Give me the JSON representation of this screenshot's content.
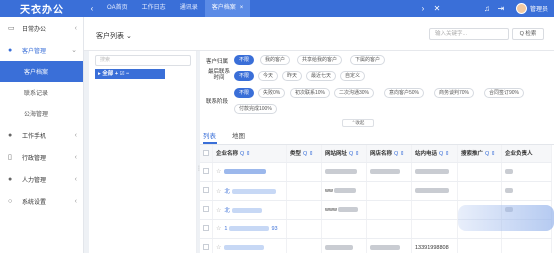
{
  "app": {
    "title": "天衣办公"
  },
  "topnav": {
    "tabs": [
      {
        "label": "OA首页",
        "active": false
      },
      {
        "label": "工作日志",
        "active": false
      },
      {
        "label": "通讯录",
        "active": false
      },
      {
        "label": "客户档案",
        "active": true
      }
    ],
    "close_glyph": "×",
    "user_name": "管理员"
  },
  "sidebar": {
    "items": [
      {
        "label": "日常办公",
        "icon": "monitor-icon"
      },
      {
        "label": "客户管理",
        "icon": "user-icon",
        "open": true
      },
      {
        "label": "工作手机",
        "icon": "user-icon"
      },
      {
        "label": "行政管理",
        "icon": "doc-icon"
      },
      {
        "label": "人力管理",
        "icon": "user-icon"
      },
      {
        "label": "系统设置",
        "icon": "circle-icon"
      }
    ],
    "subitems": [
      "客户档案",
      "联系记录",
      "公海管理"
    ]
  },
  "header": {
    "title": "客户列表",
    "search_placeholder": "输入关键字...",
    "search_button": "Q 检索"
  },
  "tree": {
    "search_placeholder": "搜索",
    "root_label": "全部",
    "root_actions": "+ ☑ −"
  },
  "filters": {
    "groups": [
      {
        "label": "客户归属",
        "options": [
          "不限",
          "我的客户",
          "共享给我的客户",
          "下属的客户"
        ]
      },
      {
        "label": "最后联系时间",
        "options": [
          "不限",
          "今天",
          "昨天",
          "最近七天",
          "自定义"
        ]
      },
      {
        "label": "联系阶段",
        "options": [
          "不限",
          "失败0%",
          "初次联系10%",
          "二次沟通30%",
          "意向客户50%",
          "商务谈判70%",
          "合同签订90%",
          "付款完成100%"
        ]
      }
    ],
    "collapse_label": "收起"
  },
  "tabs": {
    "list": "列表",
    "map": "地图"
  },
  "table": {
    "columns": [
      "企业名称",
      "类型",
      "网站网址",
      "网店名称",
      "站内电话",
      "搜索推广",
      "企业负责人"
    ],
    "rows": [
      {
        "name_prefix": "",
        "web": "",
        "phone": ""
      },
      {
        "name_prefix": "北",
        "web": "ww",
        "phone": ""
      },
      {
        "name_prefix": "北",
        "web": "www",
        "phone": ""
      },
      {
        "name_prefix": "1",
        "name_suffix": "93",
        "web": "",
        "phone": ""
      },
      {
        "name_prefix": "",
        "web": "",
        "phone": "13391998808"
      }
    ]
  },
  "colors": {
    "accent": "#3a6fd8",
    "topbar": "#3a6fd8"
  }
}
